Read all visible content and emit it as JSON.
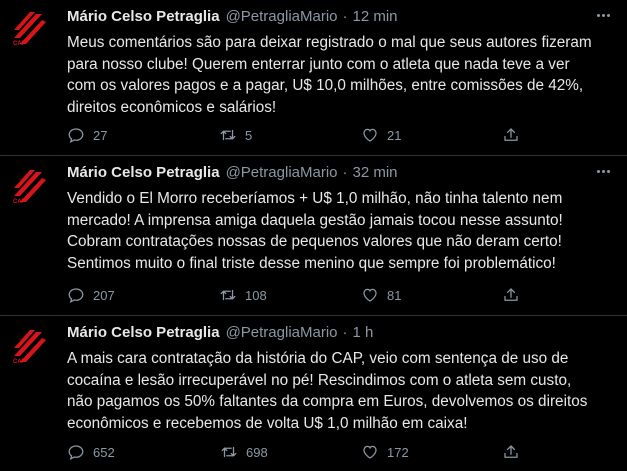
{
  "colors": {
    "background": "#000000",
    "text": "#e7e9ea",
    "muted": "#8b98a5",
    "divider": "#2f3336",
    "brand_red": "#d7141a"
  },
  "tweets": [
    {
      "name": "Mário Celso Petraglia",
      "handle": "@PetragliaMario",
      "separator": "·",
      "time": "12 min",
      "lines": [
        "Meus comentários são para deixar registrado o mal que seus autores fizeram",
        "para nosso clube! Querem enterrar junto com o atleta que nada teve a ver",
        "com os valores pagos e a pagar,  U$ 10,0 milhões, entre comissões de 42%,",
        "direitos econômicos e salários!"
      ],
      "replies": "27",
      "retweets": "5",
      "likes": "21"
    },
    {
      "name": "Mário Celso Petraglia",
      "handle": "@PetragliaMario",
      "separator": "·",
      "time": "32 min",
      "lines": [
        "Vendido o El Morro receberíamos + U$ 1,0 milhão, não tinha talento nem",
        "mercado! A imprensa amiga daquela gestão jamais tocou nesse assunto!",
        "Cobram contratações nossas de pequenos valores que não deram certo!",
        "Sentimos muito o final triste desse menino que sempre foi problemático!"
      ],
      "replies": "207",
      "retweets": "108",
      "likes": "81"
    },
    {
      "name": "Mário Celso Petraglia",
      "handle": "@PetragliaMario",
      "separator": "·",
      "time": "1 h",
      "lines": [
        "A mais cara contratação da história do CAP, veio com sentença de uso de",
        "cocaína e lesão irrecuperável no pé! Rescindimos com o atleta sem custo,",
        "não pagamos os 50% faltantes da compra em Euros, devolvemos os direitos",
        "econômicos e recebemos de volta U$ 1,0 milhão em caixa!"
      ],
      "replies": "652",
      "retweets": "698",
      "likes": "172"
    }
  ],
  "icons": {
    "avatar": "athletico-paranaense-crest-icon",
    "more": "more-dots-icon",
    "reply": "reply-bubble-icon",
    "retweet": "retweet-icon",
    "like": "heart-icon",
    "share": "share-icon"
  }
}
